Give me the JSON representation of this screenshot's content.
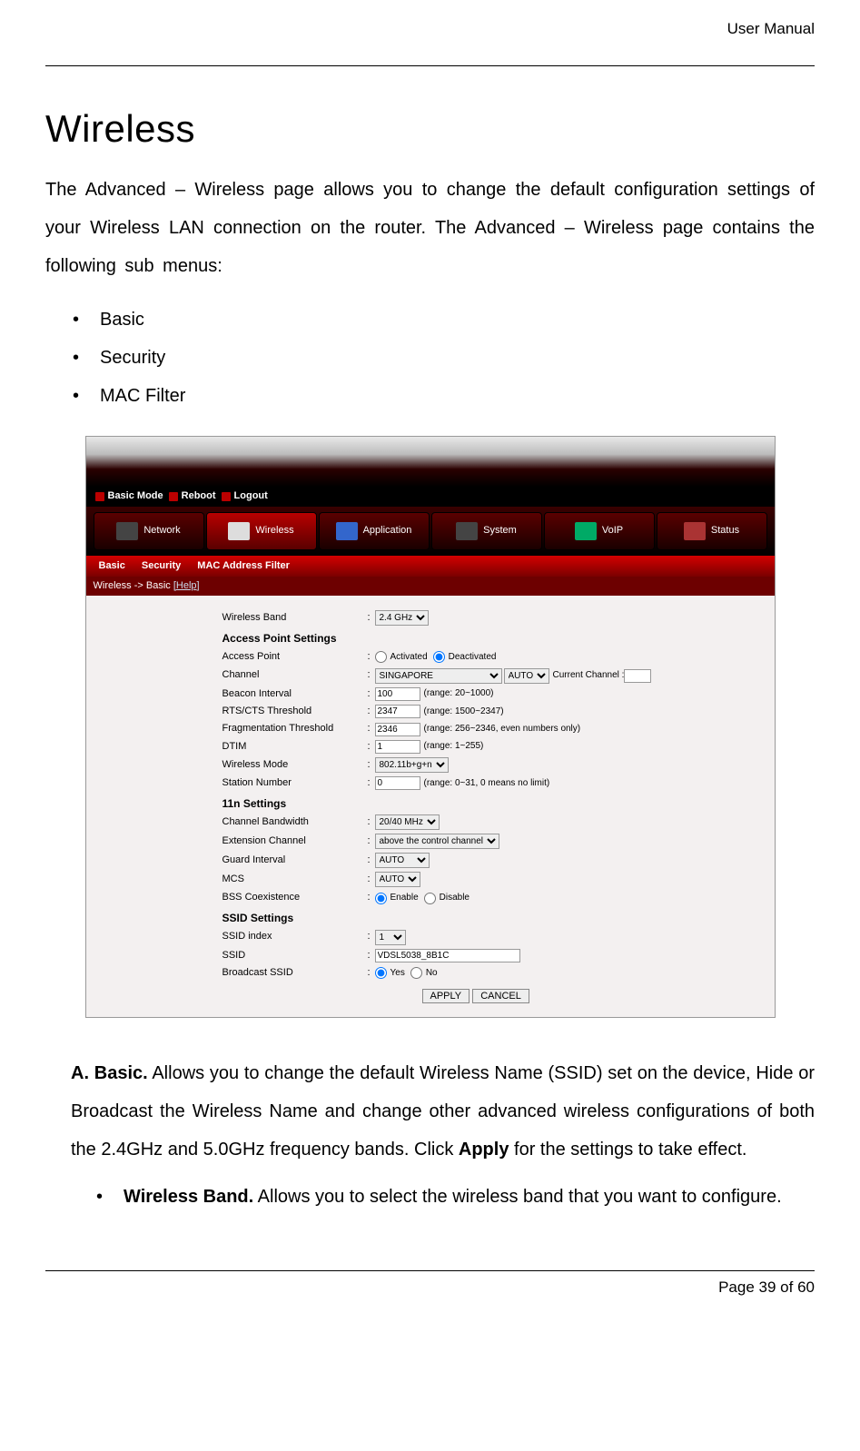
{
  "header": {
    "label": "User Manual"
  },
  "title": "Wireless",
  "intro": "The Advanced – Wireless page allows you to change the default configuration settings of your Wireless LAN connection on the router. The Advanced – Wireless page contains the following sub menus:",
  "bullets": [
    "Basic",
    "Security",
    "MAC Filter"
  ],
  "screenshot": {
    "topbar": {
      "basic_mode": "Basic Mode",
      "reboot": "Reboot",
      "logout": "Logout"
    },
    "nav": [
      "Network",
      "Wireless",
      "Application",
      "System",
      "VoIP",
      "Status"
    ],
    "subnav": [
      "Basic",
      "Security",
      "MAC Address Filter"
    ],
    "breadcrumb_prefix": "Wireless -> Basic ",
    "breadcrumb_help": "[Help]",
    "rows": {
      "wireless_band": {
        "label": "Wireless Band",
        "value": "2.4 GHz"
      },
      "ap_settings_header": "Access Point Settings",
      "access_point": {
        "label": "Access Point",
        "activated": "Activated",
        "deactivated": "Deactivated",
        "selected": "deactivated"
      },
      "channel": {
        "label": "Channel",
        "value": "SINGAPORE",
        "auto": "AUTO",
        "current_label": "Current Channel :",
        "current": ""
      },
      "beacon": {
        "label": "Beacon Interval",
        "value": "100",
        "range": "(range: 20~1000)"
      },
      "rts": {
        "label": "RTS/CTS Threshold",
        "value": "2347",
        "range": "(range: 1500~2347)"
      },
      "frag": {
        "label": "Fragmentation Threshold",
        "value": "2346",
        "range": "(range: 256~2346, even numbers only)"
      },
      "dtim": {
        "label": "DTIM",
        "value": "1",
        "range": "(range: 1~255)"
      },
      "wmode": {
        "label": "Wireless Mode",
        "value": "802.11b+g+n"
      },
      "station": {
        "label": "Station Number",
        "value": "0",
        "range": "(range: 0~31, 0 means no limit)"
      },
      "n11_header": "11n Settings",
      "chbw": {
        "label": "Channel Bandwidth",
        "value": "20/40 MHz"
      },
      "extch": {
        "label": "Extension Channel",
        "value": "above the control channel"
      },
      "guard": {
        "label": "Guard Interval",
        "value": "AUTO"
      },
      "mcs": {
        "label": "MCS",
        "value": "AUTO"
      },
      "bss": {
        "label": "BSS Coexistence",
        "enable": "Enable",
        "disable": "Disable",
        "selected": "enable"
      },
      "ssid_header": "SSID Settings",
      "ssid_index": {
        "label": "SSID index",
        "value": "1"
      },
      "ssid": {
        "label": "SSID",
        "value": "VDSL5038_8B1C"
      },
      "broadcast": {
        "label": "Broadcast SSID",
        "yes": "Yes",
        "no": "No",
        "selected": "yes"
      }
    },
    "buttons": {
      "apply": "APPLY",
      "cancel": "CANCEL"
    }
  },
  "sectionA": {
    "marker": "A.",
    "title": "Basic.",
    "text": "Allows you to change the default Wireless Name (SSID) set on the device, Hide or Broadcast the Wireless Name and change other advanced wireless configurations of both the 2.4GHz and 5.0GHz frequency bands. Click ",
    "bold_word": "Apply",
    "text_after": " for the settings to take effect.",
    "sub": {
      "title": "Wireless Band.",
      "text": " Allows you to select the wireless band that you want to configure."
    }
  },
  "footer": {
    "page_prefix": "Page ",
    "page": "39",
    "of": " of ",
    "total": "60"
  }
}
